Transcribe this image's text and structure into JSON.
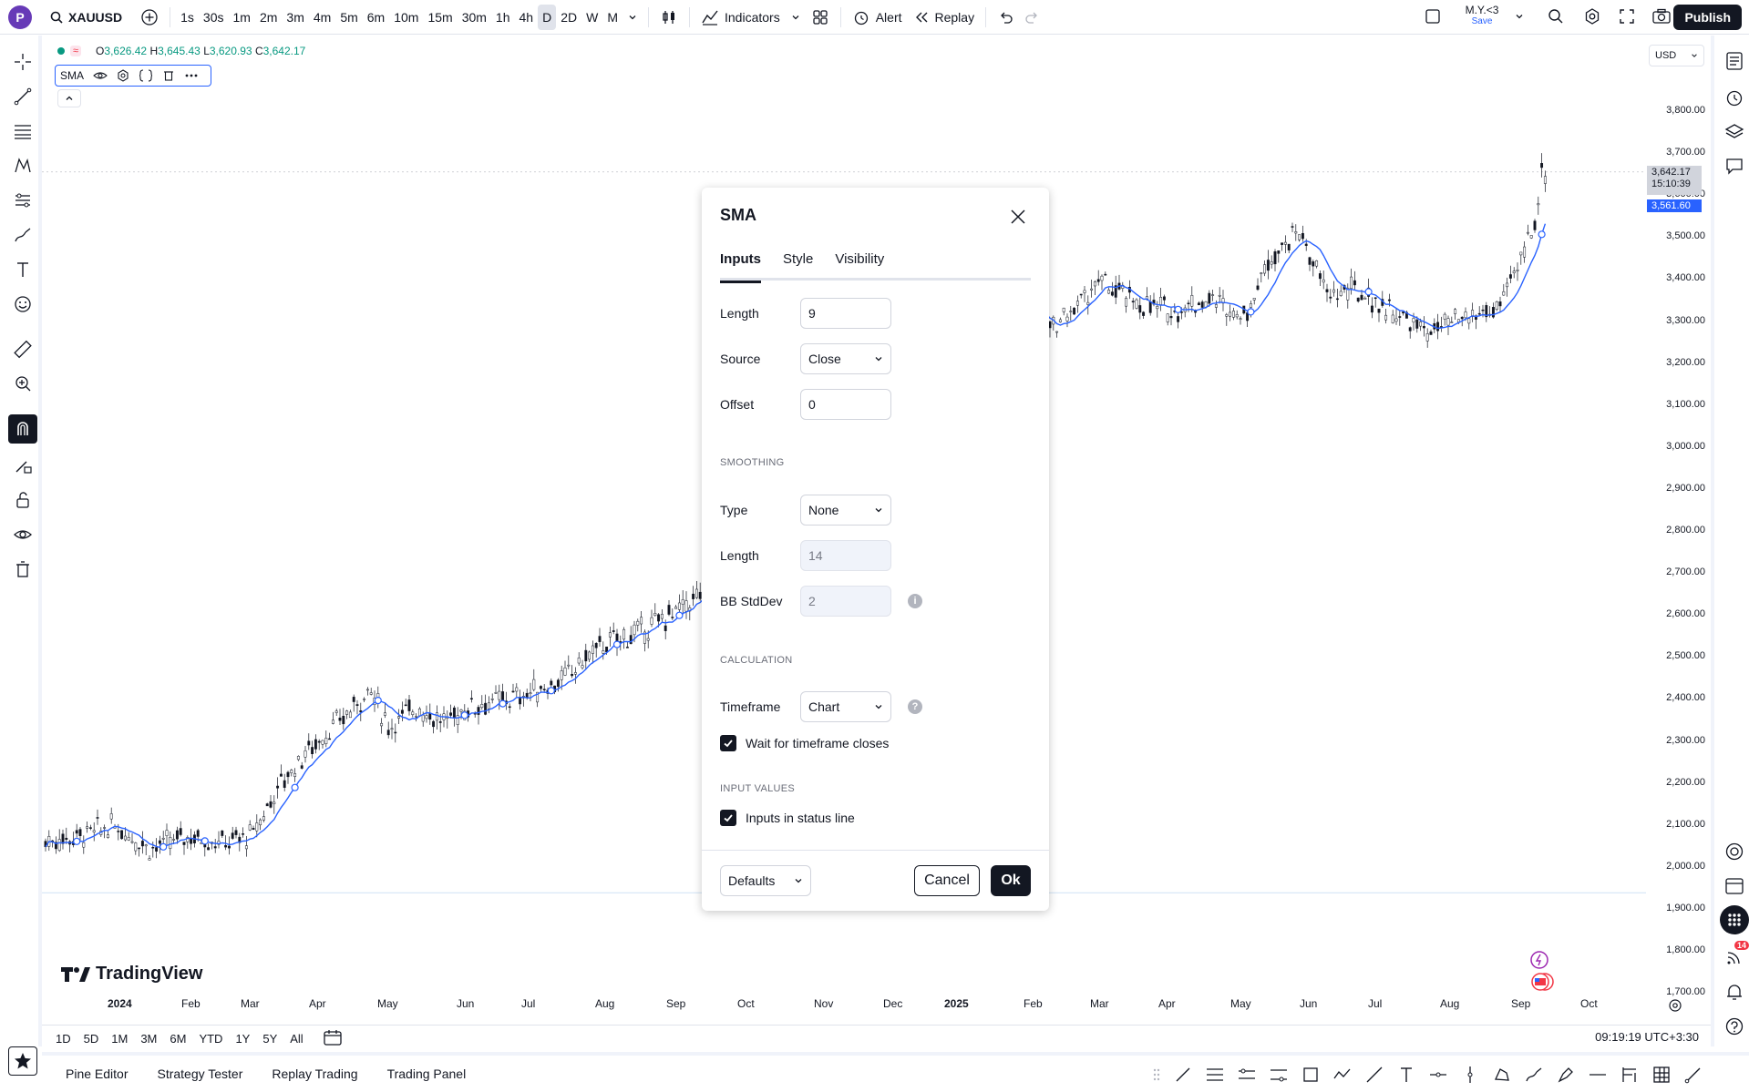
{
  "topbar": {
    "avatar": "P",
    "symbol": "XAUUSD",
    "intervals": [
      "1s",
      "30s",
      "1m",
      "2m",
      "3m",
      "4m",
      "5m",
      "6m",
      "10m",
      "15m",
      "30m",
      "1h",
      "4h",
      "D",
      "2D",
      "W",
      "M"
    ],
    "active_interval": "D",
    "indicators": "Indicators",
    "alert": "Alert",
    "replay": "Replay",
    "layout_name": "M.Y.<3",
    "layout_save": "Save",
    "publish": "Publish"
  },
  "status_line": {
    "open_label": "O",
    "open": "3,626.42",
    "high_label": "H",
    "high": "3,645.43",
    "low_label": "L",
    "low": "3,620.93",
    "close_label": "C",
    "close": "3,642.17"
  },
  "indicator_legend": {
    "name": "SMA"
  },
  "price_axis": {
    "currency": "USD",
    "labels": [
      "3,800.00",
      "3,700.00",
      "3,600.00",
      "3,500.00",
      "3,400.00",
      "3,300.00",
      "3,200.00",
      "3,100.00",
      "3,000.00",
      "2,900.00",
      "2,800.00",
      "2,700.00",
      "2,600.00",
      "2,500.00",
      "2,400.00",
      "2,300.00",
      "2,200.00",
      "2,100.00",
      "2,000.00",
      "1,900.00",
      "1,800.00",
      "1,700.00"
    ],
    "last_price": "3,642.17",
    "countdown": "15:10:39",
    "sma_value": "3,561.60"
  },
  "time_axis": {
    "labels": [
      "2024",
      "Feb",
      "Mar",
      "Apr",
      "May",
      "Jun",
      "Jul",
      "Aug",
      "Sep",
      "Oct",
      "Nov",
      "Dec",
      "2025",
      "Feb",
      "Mar",
      "Apr",
      "May",
      "Jun",
      "Jul",
      "Aug",
      "Sep",
      "Oct"
    ]
  },
  "brand": "TradingView",
  "ranges": [
    "1D",
    "5D",
    "1M",
    "3M",
    "6M",
    "YTD",
    "1Y",
    "5Y",
    "All"
  ],
  "clock": "09:19:19 UTC+3:30",
  "bottom_tabs": [
    "Pine Editor",
    "Strategy Tester",
    "Replay Trading",
    "Trading Panel"
  ],
  "right_badge": "14",
  "colors": {
    "accent": "#2962ff",
    "sma_line": "#2962ff",
    "dark": "#131722",
    "up": "#089981"
  },
  "dialog": {
    "title": "SMA",
    "tabs": [
      "Inputs",
      "Style",
      "Visibility"
    ],
    "length_label": "Length",
    "length_value": "9",
    "source_label": "Source",
    "source_value": "Close",
    "offset_label": "Offset",
    "offset_value": "0",
    "smoothing_section": "SMOOTHING",
    "type_label": "Type",
    "type_value": "None",
    "smooth_length_label": "Length",
    "smooth_length_value": "14",
    "bb_label": "BB StdDev",
    "bb_value": "2",
    "calculation_section": "CALCULATION",
    "timeframe_label": "Timeframe",
    "timeframe_value": "Chart",
    "wait_label": "Wait for timeframe closes",
    "input_values_section": "INPUT VALUES",
    "inputs_status_label": "Inputs in status line",
    "defaults": "Defaults",
    "cancel": "Cancel",
    "ok": "Ok"
  }
}
